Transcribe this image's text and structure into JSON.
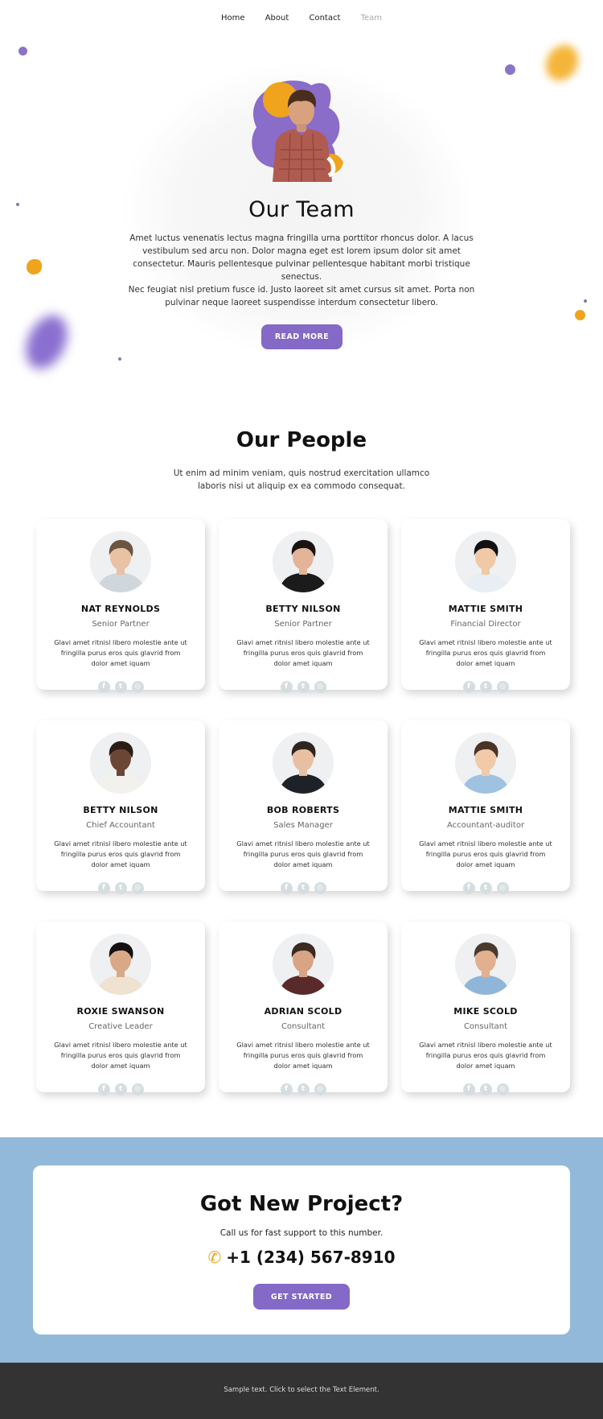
{
  "nav": {
    "items": [
      {
        "label": "Home"
      },
      {
        "label": "About"
      },
      {
        "label": "Contact"
      },
      {
        "label": "Team"
      }
    ]
  },
  "hero": {
    "title": "Our Team",
    "paragraph1": "Amet luctus venenatis lectus magna fringilla urna porttitor rhoncus dolor. A lacus vestibulum sed arcu non. Dolor magna eget est lorem ipsum dolor sit amet consectetur. Mauris pellentesque pulvinar pellentesque habitant morbi tristique senectus.",
    "paragraph2": "Nec feugiat nisl pretium fusce id. Justo laoreet sit amet cursus sit amet. Porta non pulvinar neque laoreet suspendisse interdum consectetur libero.",
    "button_label": "READ MORE"
  },
  "people": {
    "title": "Our People",
    "subtitle": "Ut enim ad minim veniam, quis nostrud exercitation ullamco laboris nisi ut aliquip ex ea commodo consequat.",
    "cards": [
      {
        "name": "NAT REYNOLDS",
        "role": "Senior Partner",
        "text": "Glavi amet ritnisl libero molestie ante ut fringilla purus eros quis glavrid from dolor amet iquam"
      },
      {
        "name": "BETTY NILSON",
        "role": "Senior Partner",
        "text": "Glavi amet ritnisl libero molestie ante ut fringilla purus eros quis glavrid from dolor amet iquam"
      },
      {
        "name": "MATTIE SMITH",
        "role": "Financial Director",
        "text": "Glavi amet ritnisl libero molestie ante ut fringilla purus eros quis glavrid from dolor amet iquam"
      },
      {
        "name": "BETTY NILSON",
        "role": "Chief Accountant",
        "text": "Glavi amet ritnisl libero molestie ante ut fringilla purus eros quis glavrid from dolor amet iquam"
      },
      {
        "name": "BOB ROBERTS",
        "role": "Sales Manager",
        "text": "Glavi amet ritnisl libero molestie ante ut fringilla purus eros quis glavrid from dolor amet iquam"
      },
      {
        "name": "MATTIE SMITH",
        "role": "Accountant-auditor",
        "text": "Glavi amet ritnisl libero molestie ante ut fringilla purus eros quis glavrid from dolor amet iquam"
      },
      {
        "name": "ROXIE SWANSON",
        "role": "Creative Leader",
        "text": "Glavi amet ritnisl libero molestie ante ut fringilla purus eros quis glavrid from dolor amet iquam"
      },
      {
        "name": "ADRIAN SCOLD",
        "role": "Consultant",
        "text": "Glavi amet ritnisl libero molestie ante ut fringilla purus eros quis glavrid from dolor amet iquam"
      },
      {
        "name": "MIKE SCOLD",
        "role": "Consultant",
        "text": "Glavi amet ritnisl libero molestie ante ut fringilla purus eros quis glavrid from dolor amet iquam"
      }
    ],
    "social_icons": [
      "facebook-icon",
      "twitter-icon",
      "instagram-icon"
    ]
  },
  "cta": {
    "title": "Got New Project?",
    "subtitle": "Call us for fast support to this number.",
    "phone": "+1 (234) 567-8910",
    "button_label": "GET STARTED"
  },
  "footer": {
    "text": "Sample text. Click to select the Text Element."
  },
  "colors": {
    "accent": "#8469c6",
    "orange": "#f0a31c",
    "cta_band": "#92b9d9",
    "footer": "#333333"
  }
}
